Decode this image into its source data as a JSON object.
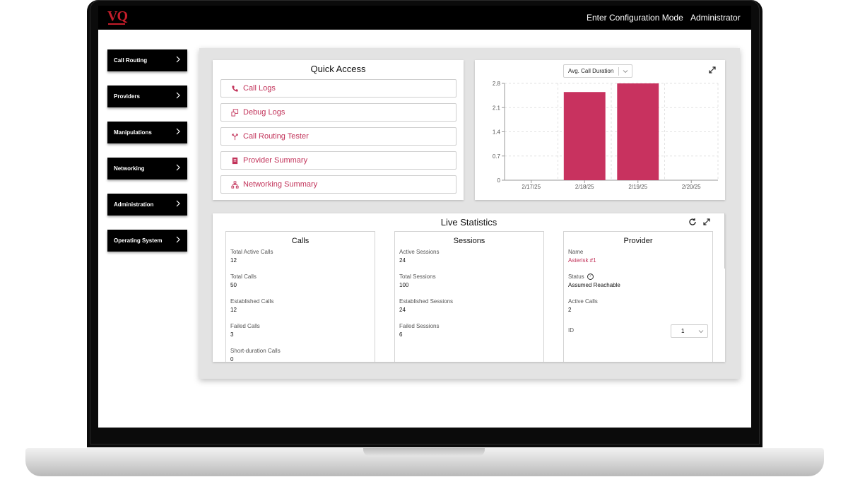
{
  "app": {
    "logo": "VQ"
  },
  "topbar": {
    "config_mode": "Enter Configuration Mode",
    "user": "Administrator"
  },
  "sidebar": {
    "items": [
      {
        "label": "Call Routing"
      },
      {
        "label": "Providers"
      },
      {
        "label": "Manipulations"
      },
      {
        "label": "Networking"
      },
      {
        "label": "Administration"
      },
      {
        "label": "Operating System"
      }
    ]
  },
  "quick_access": {
    "title": "Quick Access",
    "items": [
      {
        "label": "Call Logs",
        "icon": "phone-icon"
      },
      {
        "label": "Debug Logs",
        "icon": "debug-icon"
      },
      {
        "label": "Call Routing Tester",
        "icon": "routing-icon"
      },
      {
        "label": "Provider Summary",
        "icon": "summary-icon"
      },
      {
        "label": "Networking Summary",
        "icon": "network-icon"
      }
    ]
  },
  "chart_panel": {
    "metric_selected": "Avg. Call Duration"
  },
  "chart_data": {
    "type": "bar",
    "categories": [
      "2/17/25",
      "2/18/25",
      "2/19/25",
      "2/20/25"
    ],
    "values": [
      0,
      2.55,
      2.8,
      0
    ],
    "yticks": [
      "0",
      "0.7",
      "1.4",
      "2.1",
      "2.8"
    ],
    "ylim": [
      0,
      2.8
    ],
    "grid": true,
    "bar_color": "#c8325f"
  },
  "live_statistics": {
    "title": "Live Statistics",
    "calls": {
      "title": "Calls",
      "total_active_label": "Total Active Calls",
      "total_active": "12",
      "total_label": "Total Calls",
      "total": "50",
      "established_label": "Established Calls",
      "established": "12",
      "failed_label": "Failed Calls",
      "failed": "3",
      "short_label": "Short-duration Calls",
      "short": "0"
    },
    "sessions": {
      "title": "Sessions",
      "active_label": "Active Sessions",
      "active": "24",
      "total_label": "Total Sessions",
      "total": "100",
      "established_label": "Established Sessions",
      "established": "24",
      "failed_label": "Failed Sessions",
      "failed": "6"
    },
    "provider": {
      "title": "Provider",
      "name_label": "Name",
      "name": "Asterisk #1",
      "status_label": "Status",
      "status": "Assumed Reachable",
      "active_calls_label": "Active Calls",
      "active_calls": "2",
      "id_label": "ID",
      "id": "1"
    }
  },
  "colors": {
    "accent": "#c2335a",
    "brand_red": "#c41d2a",
    "topbar": "#000000"
  }
}
